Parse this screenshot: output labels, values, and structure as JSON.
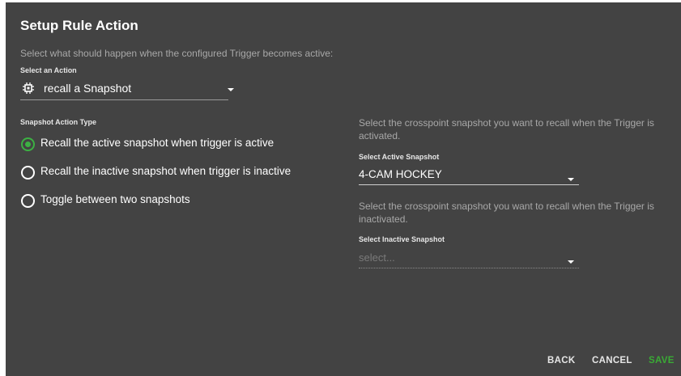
{
  "dialog": {
    "title": "Setup Rule Action",
    "description": "Select what should happen when the configured Trigger becomes active:"
  },
  "action": {
    "label": "Select an Action",
    "value": "recall a Snapshot",
    "icon": "chip-icon"
  },
  "snapshot_type": {
    "label": "Snapshot Action Type",
    "options": [
      {
        "label": "Recall the active snapshot when trigger is active",
        "checked": true
      },
      {
        "label": "Recall the inactive snapshot when trigger is inactive",
        "checked": false
      },
      {
        "label": "Toggle between two snapshots",
        "checked": false
      }
    ]
  },
  "active_snapshot": {
    "description": "Select the crosspoint snapshot you want to recall when the Trigger is activated.",
    "label": "Select Active Snapshot",
    "value": "4-CAM HOCKEY"
  },
  "inactive_snapshot": {
    "description": "Select the crosspoint snapshot you want to recall when the Trigger is inactivated.",
    "label": "Select Inactive Snapshot",
    "placeholder": "select..."
  },
  "footer": {
    "back": "BACK",
    "cancel": "CANCEL",
    "save": "SAVE"
  },
  "colors": {
    "background": "#434343",
    "accent_green": "#3cb043",
    "muted_text": "#a8a8a8"
  }
}
